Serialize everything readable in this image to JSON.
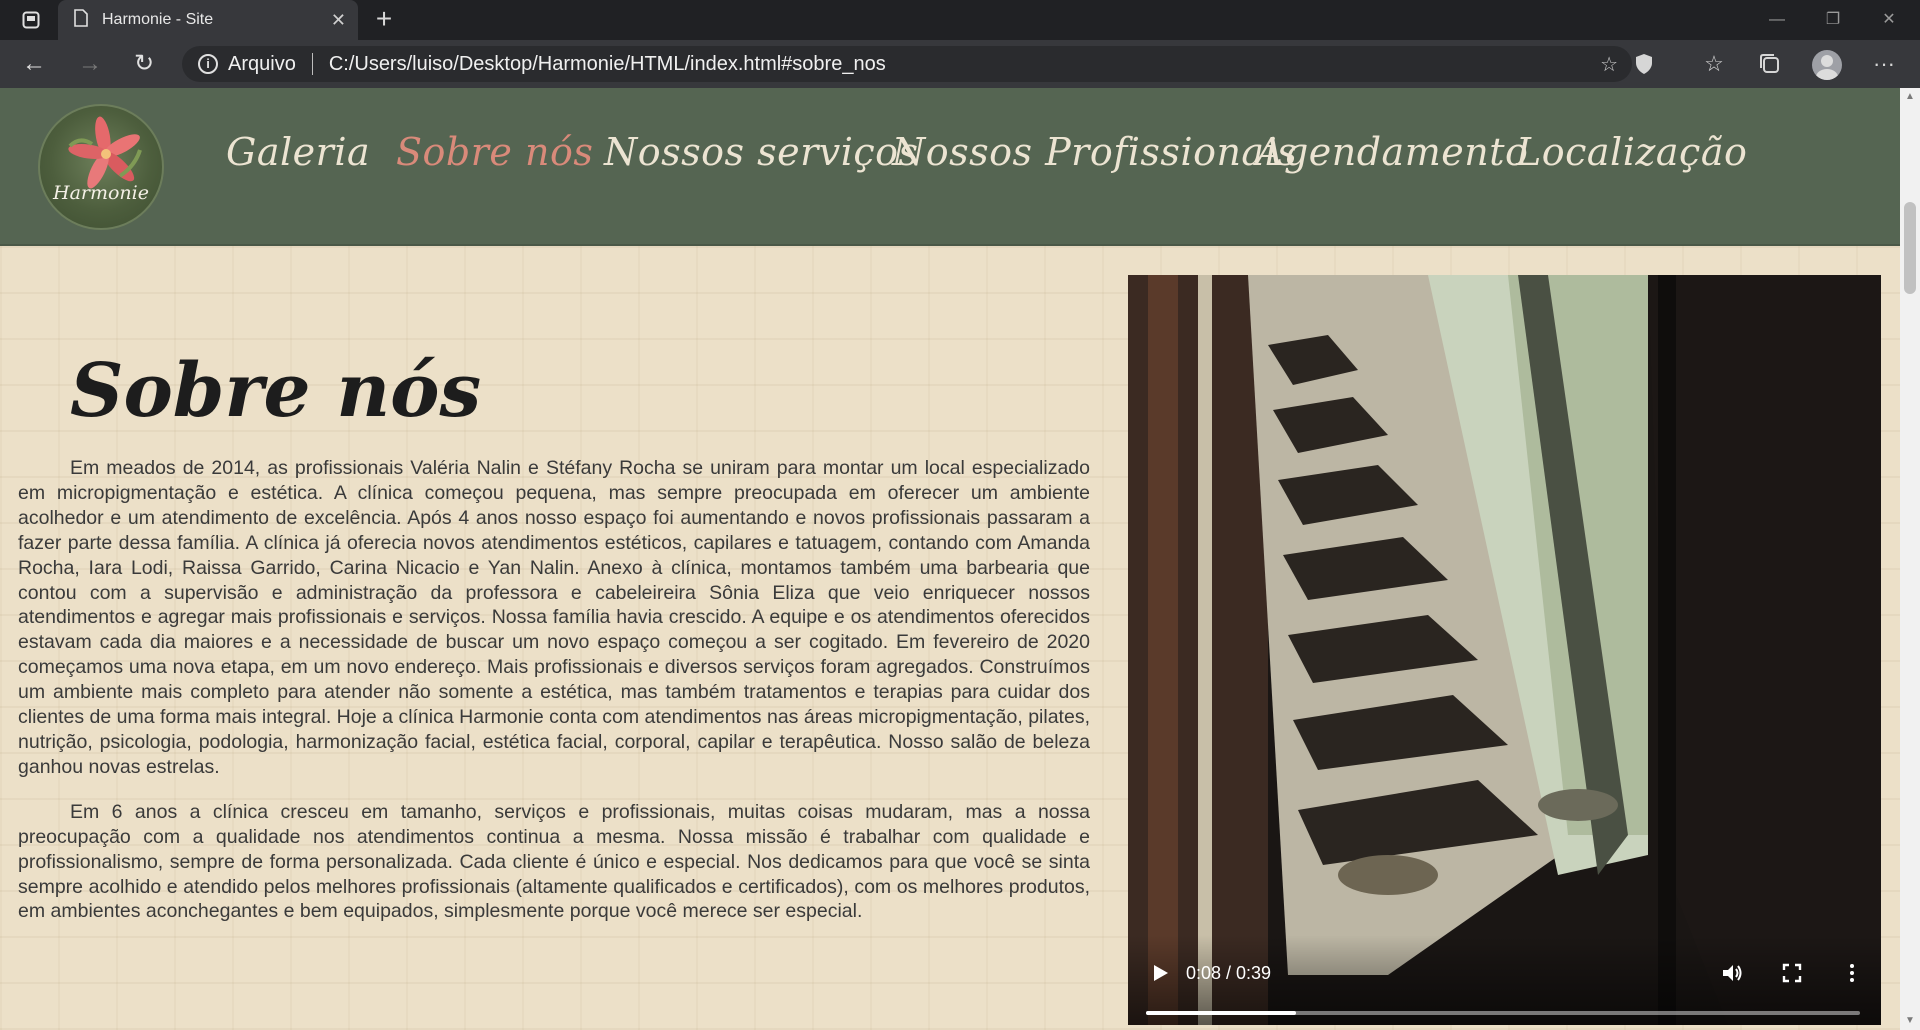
{
  "browser": {
    "tab_title": "Harmonie - Site",
    "site_label": "Arquivo",
    "url": "C:/Users/luiso/Desktop/Harmonie/HTML/index.html#sobre_nos"
  },
  "header": {
    "logo_text": "Harmonie",
    "nav": [
      {
        "label": "Galeria",
        "active": false
      },
      {
        "label": "Sobre nós",
        "active": true
      },
      {
        "label": "Nossos serviços",
        "active": false
      },
      {
        "label": "Nossos Profissionais",
        "active": false
      },
      {
        "label": "Agendamento",
        "active": false
      },
      {
        "label": "Localização",
        "active": false
      }
    ]
  },
  "about": {
    "title": "Sobre nós",
    "paragraphs": [
      "Em meados de 2014, as profissionais Valéria Nalin e Stéfany Rocha se uniram para montar um local especializado em micropigmentação e estética. A clínica começou pequena, mas sempre preocupada em oferecer um ambiente acolhedor e um atendimento de excelência. Após 4 anos nosso espaço foi aumentando e novos profissionais passaram a fazer parte dessa família. A clínica já oferecia novos atendimentos estéticos, capilares e tatuagem, contando com Amanda Rocha, Iara Lodi, Raissa Garrido, Carina Nicacio e Yan Nalin. Anexo à clínica, montamos também uma barbearia que contou com a supervisão e administração da professora e cabeleireira Sônia Eliza que veio enriquecer nossos atendimentos e agregar mais profissionais e serviços. Nossa família havia crescido. A equipe e os atendimentos oferecidos estavam cada dia maiores e a necessidade de buscar um novo espaço começou a ser cogitado. Em fevereiro de 2020 começamos uma nova etapa, em um novo endereço. Mais profissionais e diversos serviços foram agregados. Construímos um ambiente mais completo para atender não somente a estética, mas também tratamentos e terapias para cuidar dos clientes de uma forma mais integral. Hoje a clínica Harmonie conta com atendimentos nas áreas micropigmentação, pilates, nutrição, psicologia, podologia, harmonização facial, estética facial, corporal, capilar e terapêutica. Nosso salão de beleza ganhou novas estrelas.",
      "Em 6 anos a clínica cresceu em tamanho, serviços e profissionais, muitas coisas mudaram, mas a nossa preocupação com a qualidade nos atendimentos continua a mesma. Nossa missão é trabalhar com qualidade e profissionalismo, sempre de forma personalizada. Cada cliente é único e especial. Nos dedicamos para que você se sinta sempre acolhido e atendido pelos melhores profissionais (altamente qualificados e certificados), com os melhores produtos, em ambientes aconchegantes e bem equipados, simplesmente porque você merece ser especial."
    ]
  },
  "video": {
    "time": "0:08 / 0:39",
    "progress": 0.21
  },
  "icons": {
    "tab_actions": "tab-actions-icon",
    "page": "page-icon",
    "close": "close-icon",
    "new_tab": "plus-icon",
    "back": "arrow-left-icon",
    "forward": "arrow-right-icon",
    "refresh": "refresh-icon",
    "info": "info-icon",
    "add_favorite": "star-plus-icon",
    "extension": "shield-icon",
    "favorites": "favorites-icon",
    "collections": "collections-icon",
    "profile": "avatar-icon",
    "more": "more-icon",
    "play": "play-icon",
    "volume": "volume-icon",
    "fullscreen": "fullscreen-icon",
    "video_options": "more-vertical-icon"
  },
  "colors": {
    "header_bg": "#556552",
    "nav_text": "#ece4d2",
    "nav_active": "#d98a7a",
    "page_bg": "#ece0c8",
    "body_text": "#3a3a3a"
  }
}
